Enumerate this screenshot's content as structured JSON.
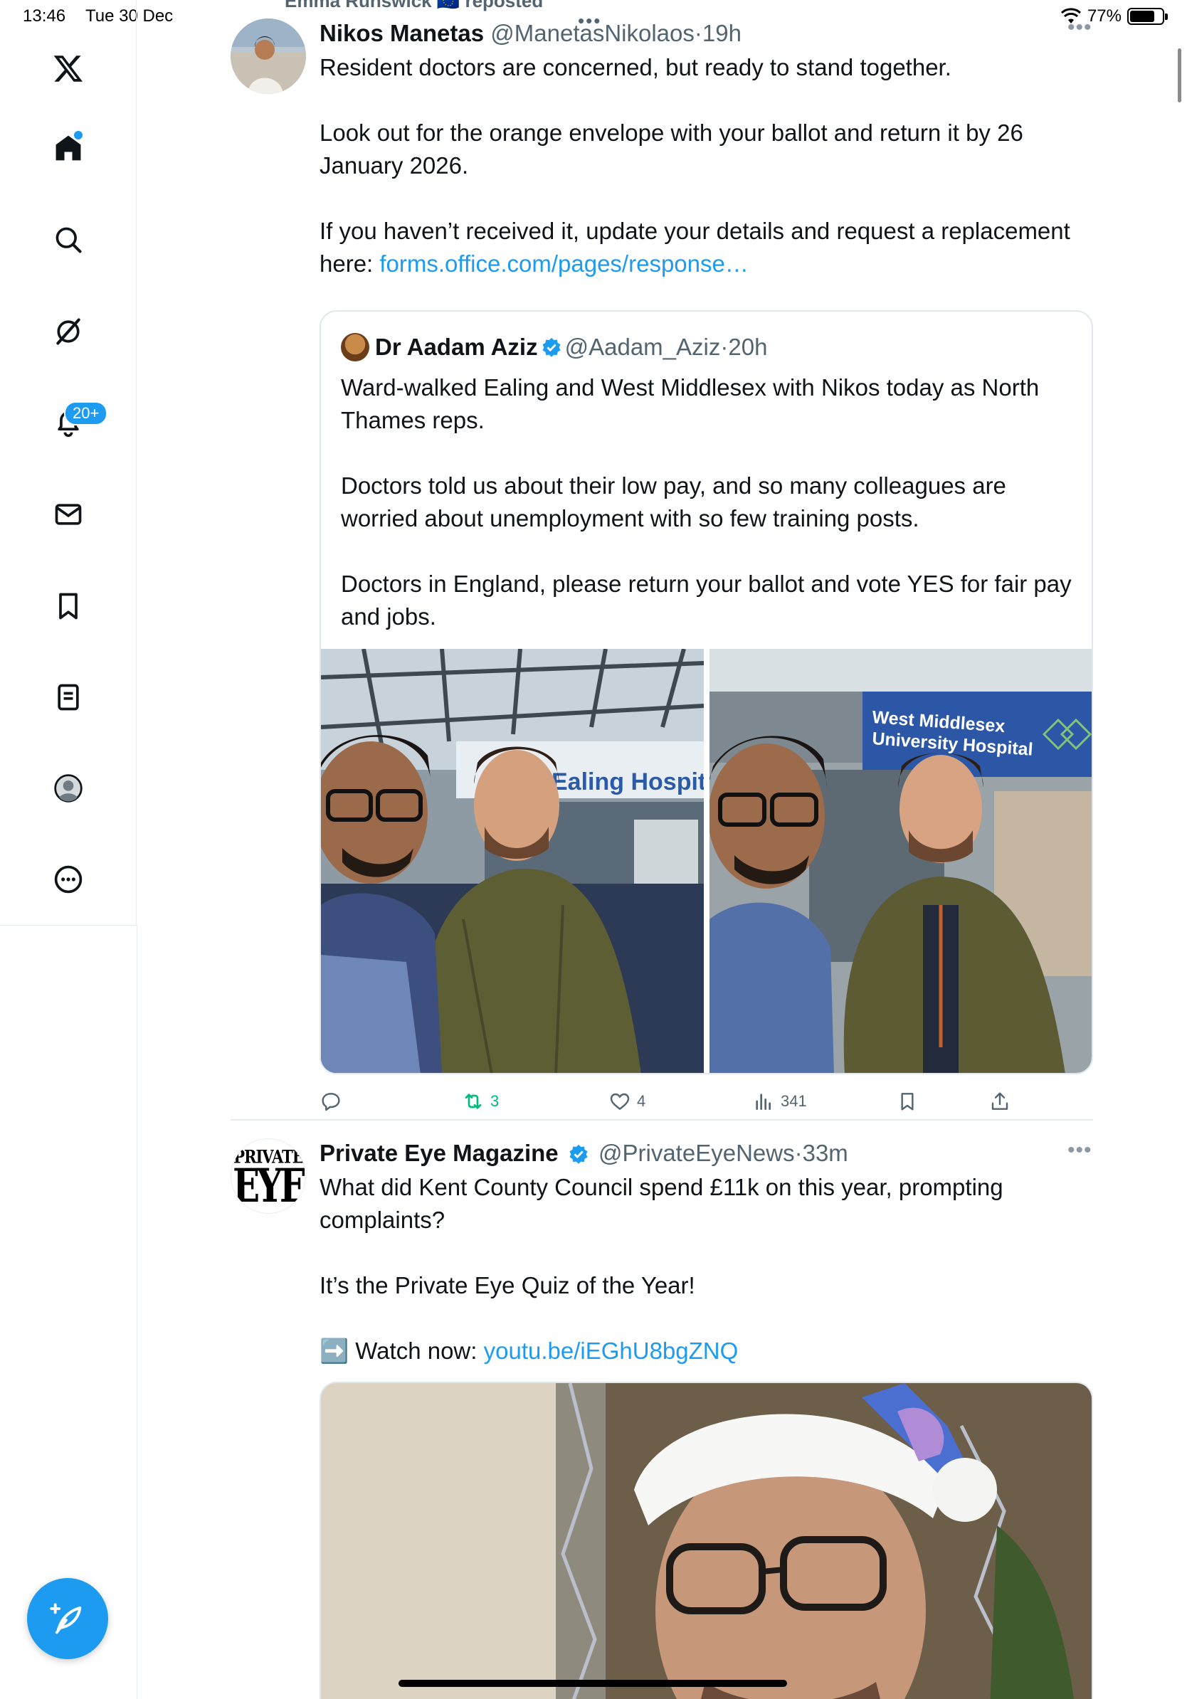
{
  "status_bar": {
    "time": "13:46",
    "date": "Tue 30 Dec",
    "battery": "77%",
    "battery_level": 0.77
  },
  "sidebar": {
    "notifications_badge": "20+",
    "items": [
      {
        "name": "home",
        "icon": "home-icon"
      },
      {
        "name": "explore",
        "icon": "search-icon"
      },
      {
        "name": "grok",
        "icon": "grok-icon"
      },
      {
        "name": "notifications",
        "icon": "bell-icon"
      },
      {
        "name": "messages",
        "icon": "mail-icon"
      },
      {
        "name": "bookmarks",
        "icon": "bookmark-icon"
      },
      {
        "name": "lists",
        "icon": "list-icon"
      },
      {
        "name": "profile",
        "icon": "profile-icon"
      },
      {
        "name": "more",
        "icon": "more-icon"
      }
    ]
  },
  "feed": {
    "repost_banner": "Emma Runswick 🇪🇺 reposted",
    "tweets": [
      {
        "name": "Nikos Manetas",
        "handle": "@ManetasNikolaos",
        "time": "19h",
        "text": "Resident doctors are concerned, but ready to stand together.\n\nLook out for the orange envelope with your ballot and return it by 26 January 2026.\n\nIf you haven’t received it, update your details and request a replacement here: ",
        "link": "forms.office.com/pages/response…",
        "quote": {
          "name": "Dr Aadam Aziz",
          "handle": "@Aadam_Aziz",
          "time": "20h",
          "text": "Ward-walked Ealing and West Middlesex with Nikos today as North Thames reps.\n\nDoctors told us about their low pay, and so many colleagues are worried about unemployment with so few training posts.\n\nDoctors in England, please return your ballot and vote YES for fair pay and jobs.",
          "photo_left_sign": "Ealing Hospita",
          "photo_right_sign_line1": "West Middlesex",
          "photo_right_sign_line2": "University Hospital"
        },
        "stats": {
          "replies": "",
          "reposts": "3",
          "likes": "4",
          "views": "341"
        }
      },
      {
        "name": "Private Eye Magazine",
        "handle": "@PrivateEyeNews",
        "time": "33m",
        "logo_top": "PRIVATE",
        "logo_bottom": "EYE",
        "text": "What did Kent County Council spend £11k on this year, prompting complaints?\n\nIt’s the Private Eye Quiz of the Year!\n\n➡️ Watch now: ",
        "link": "youtu.be/iEGhU8bgZNQ"
      }
    ]
  },
  "colors": {
    "accent": "#1d9bf0",
    "repost_active": "#00ba7c",
    "text_secondary": "#536471"
  }
}
